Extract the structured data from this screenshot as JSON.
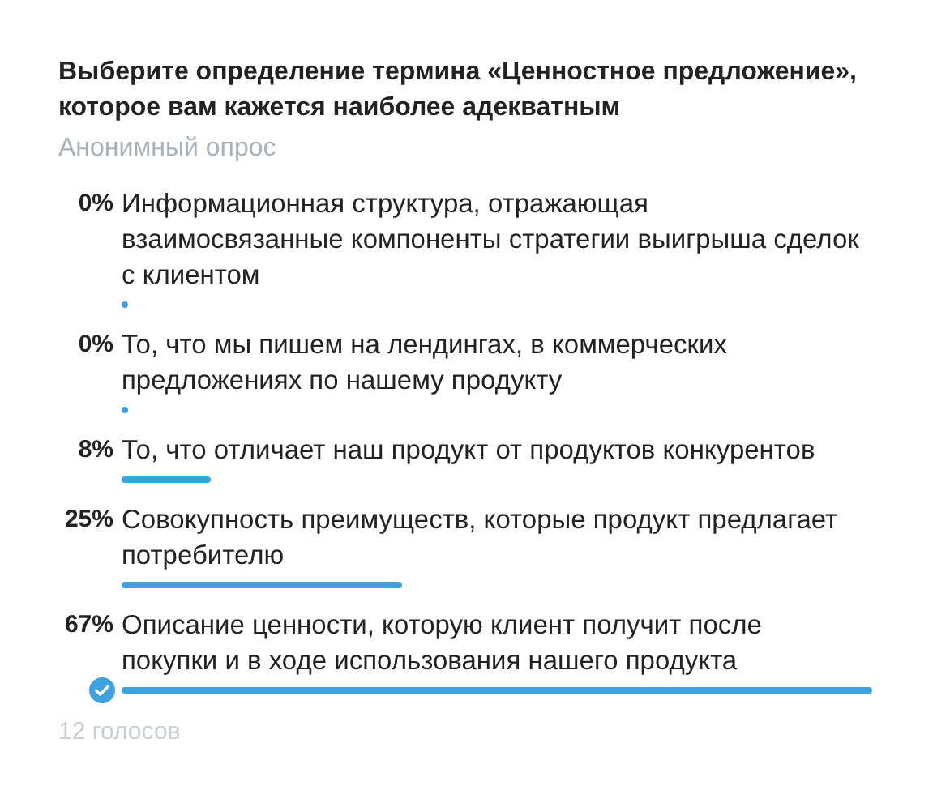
{
  "poll": {
    "question": "Выберите определение термина «Ценностное предложение», которое вам кажется наиболее адекватным",
    "type_label": "Анонимный опрос",
    "options": [
      {
        "percent": "0%",
        "text": "Информационная структура, отражающая взаимосвязанные компоненты стратегии выигрыша сделок с клиентом",
        "selected": false
      },
      {
        "percent": "0%",
        "text": "То, что мы пишем на лендингах, в коммерческих предложениях по нашему продукту",
        "selected": false
      },
      {
        "percent": "8%",
        "text": "То, что отличает наш продукт от продуктов конкурентов",
        "selected": false
      },
      {
        "percent": "25%",
        "text": "Совокупность преимуществ, которые продукт предлагает потребителю",
        "selected": false
      },
      {
        "percent": "67%",
        "text": "Описание ценности, которую клиент получит после покупки и в ходе использования нашего продукта",
        "selected": true
      }
    ],
    "votes": "12 голосов"
  }
}
